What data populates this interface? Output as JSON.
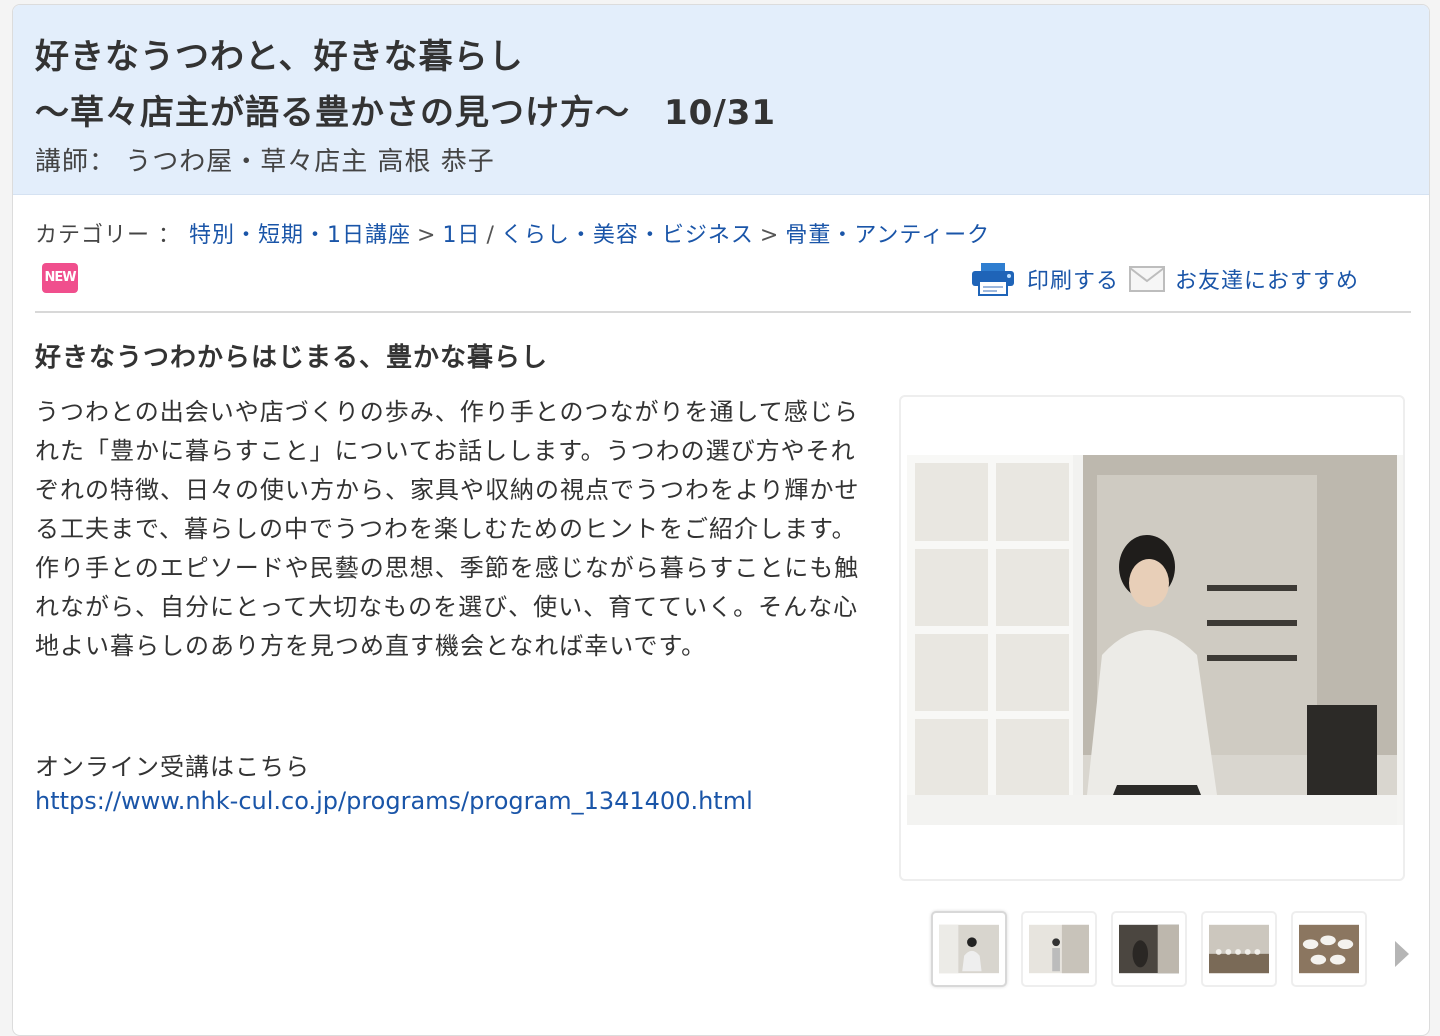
{
  "header": {
    "title_line1": "好きなうつわと、好きな暮らし",
    "title_line2": "〜草々店主が語る豊かさの見つけ方〜",
    "date": "10/31",
    "lecturer": "講師： うつわ屋・草々店主 高根 恭子"
  },
  "category": {
    "label": "カテゴリー ：",
    "path1": [
      "特別・短期・1日講座",
      "1日"
    ],
    "slash": "/",
    "path2": [
      "くらし・美容・ビジネス",
      "骨董・アンティーク"
    ],
    "arrow": ">"
  },
  "badge": {
    "text": "NEW",
    "color": "#f04f8d"
  },
  "actions": {
    "print": "印刷する",
    "recommend": "お友達におすすめ"
  },
  "main": {
    "subheading": "好きなうつわからはじまる、豊かな暮らし",
    "paragraph1": "うつわとの出会いや店づくりの歩み、作り手とのつながりを通して感じられた「豊かに暮らすこと」についてお話しします。うつわの選び方やそれぞれの特徴、日々の使い方から、家具や収納の視点でうつわをより輝かせる工夫まで、暮らしの中でうつわを楽しむためのヒントをご紹介します。",
    "paragraph2": "作り手とのエピソードや民藝の思想、季節を感じながら暮らすことにも触れながら、自分にとって大切なものを選び、使い、育てていく。そんな心地よい暮らしのあり方を見つめ直す機会となれば幸いです。",
    "online_label": "オンライン受講はこちら",
    "online_url": "https://www.nhk-cul.co.jp/programs/program_1341400.html"
  },
  "gallery": {
    "thumbnail_count": 5,
    "active_index": 0
  },
  "colors": {
    "accent_link": "#1a55a8",
    "header_bg": "#e3eefb"
  }
}
